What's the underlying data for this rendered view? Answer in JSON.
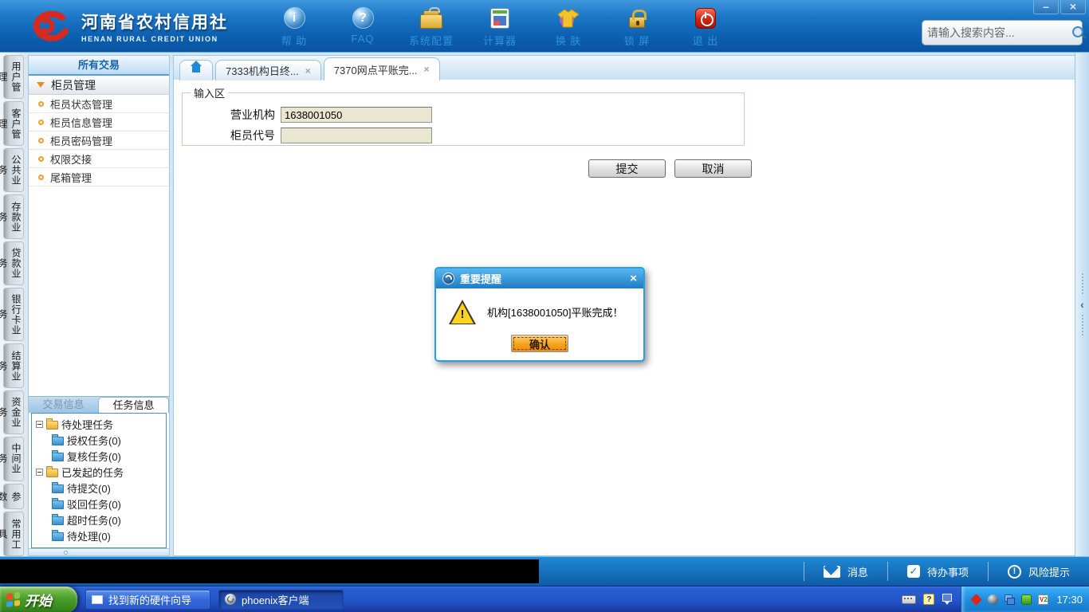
{
  "colors": {
    "header_blue": "#0c5dad",
    "accent_blue": "#1e8ad2",
    "dialog_border": "#25a0e8",
    "warning_yellow": "#ffd21e",
    "confirm_orange": "#f5a21c",
    "input_beige": "#eae6d2",
    "taskbar_blue": "#2153c6",
    "start_green": "#4a9e2a",
    "logo_red": "#d42a20"
  },
  "icons": {
    "minimize": "–",
    "close": "×",
    "help_i": "i",
    "faq_q": "?",
    "check": "✓",
    "warning": "!",
    "risk": "!",
    "quick_help": "?",
    "v2_v": "V",
    "v2_2": "2",
    "chevron_left": "‹"
  },
  "header": {
    "brand": {
      "title": "河南省农村信用社",
      "subtitle": "HENAN RURAL CREDIT UNION"
    },
    "toolbar": [
      {
        "id": "help",
        "label": "帮 助"
      },
      {
        "id": "faq",
        "label": "FAQ"
      },
      {
        "id": "system-config",
        "label": "系统配置"
      },
      {
        "id": "calculator",
        "label": "计算器"
      },
      {
        "id": "skin",
        "label": "换 肤"
      },
      {
        "id": "lock-screen",
        "label": "锁 屏"
      },
      {
        "id": "exit",
        "label": "退 出"
      }
    ],
    "search": {
      "placeholder": "请输入搜索内容..."
    }
  },
  "vertical_tabs": [
    "用户管理",
    "客户管理",
    "公共业务",
    "存款业务",
    "贷款业务",
    "银行卡业务",
    "结算业务",
    "资金业务",
    "中间业务",
    "参数",
    "常用工具"
  ],
  "sidebar": {
    "header": "所有交易",
    "group": {
      "label": "柜员管理",
      "expanded": true
    },
    "items": [
      "柜员状态管理",
      "柜员信息管理",
      "柜员密码管理",
      "权限交接",
      "尾箱管理"
    ],
    "info_tabs": [
      {
        "label": "交易信息",
        "active": false
      },
      {
        "label": "任务信息",
        "active": true
      }
    ],
    "task_tree": [
      {
        "label": "待处理任务",
        "children": [
          "授权任务(0)",
          "复核任务(0)"
        ]
      },
      {
        "label": "已发起的任务",
        "children": [
          "待提交(0)",
          "驳回任务(0)",
          "超时任务(0)",
          "待处理(0)"
        ]
      }
    ]
  },
  "tabs": [
    {
      "id": "home",
      "label": "",
      "active": false
    },
    {
      "id": "7333",
      "label": "7333机构日终...",
      "close": "×",
      "active": false
    },
    {
      "id": "7370",
      "label": "7370网点平账完...",
      "close": "×",
      "active": true
    }
  ],
  "form": {
    "legend": "输入区",
    "fields": [
      {
        "label": "营业机构",
        "value": "1638001050"
      },
      {
        "label": "柜员代号",
        "value": ""
      }
    ],
    "buttons": {
      "submit": "提交",
      "cancel": "取消"
    }
  },
  "dialog": {
    "title": "重要提醒",
    "message": "机构[1638001050]平账完成！",
    "confirm": "确认",
    "close": "×"
  },
  "status_bar": {
    "items": [
      {
        "id": "messages",
        "label": "消息"
      },
      {
        "id": "todos",
        "label": "待办事项"
      },
      {
        "id": "risk",
        "label": "风险提示"
      }
    ]
  },
  "taskbar": {
    "start": "开始",
    "tasks": [
      {
        "label": "找到新的硬件向导",
        "active": false
      },
      {
        "label": "phoenix客户端",
        "active": true
      }
    ],
    "clock": "17:30"
  }
}
